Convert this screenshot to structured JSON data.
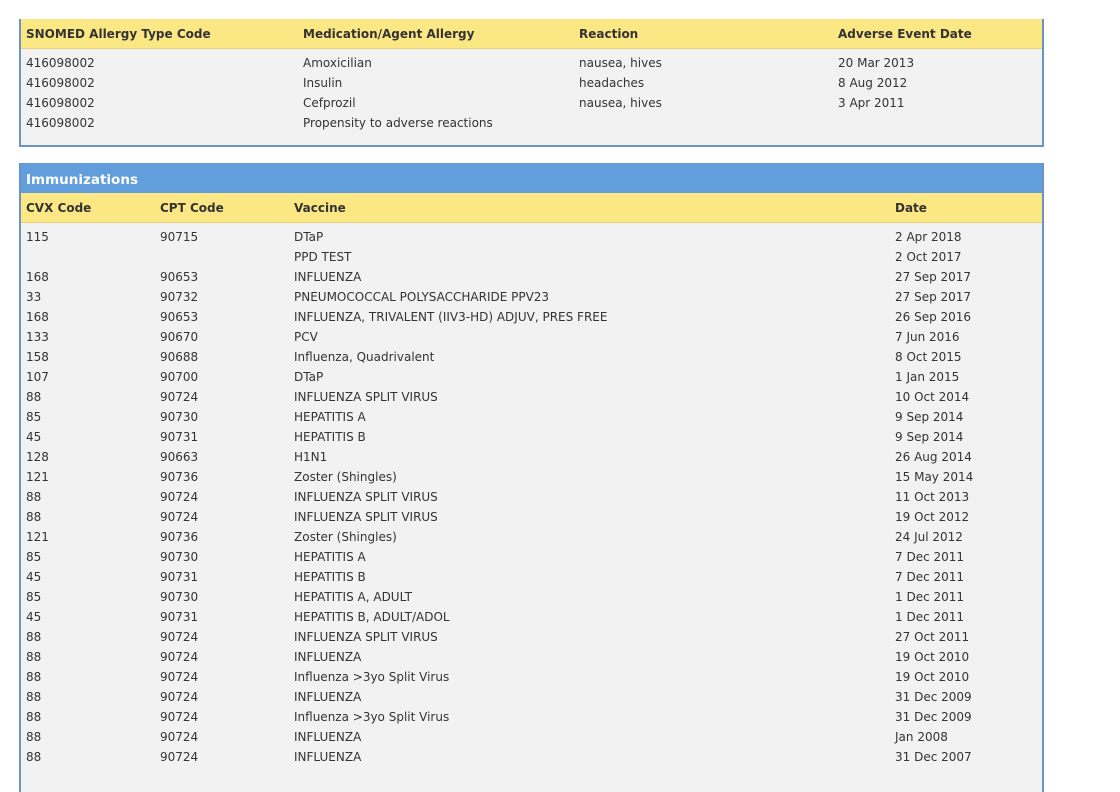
{
  "allergies": {
    "columns": [
      "SNOMED Allergy Type Code",
      "Medication/Agent Allergy",
      "Reaction",
      "Adverse Event Date"
    ],
    "rows": [
      {
        "code": "416098002",
        "agent": "Amoxicilian",
        "reaction": "nausea, hives",
        "date": "20 Mar 2013"
      },
      {
        "code": "416098002",
        "agent": "Insulin",
        "reaction": "headaches",
        "date": "8 Aug 2012"
      },
      {
        "code": "416098002",
        "agent": "Cefprozil",
        "reaction": "nausea, hives",
        "date": "3 Apr 2011"
      },
      {
        "code": "416098002",
        "agent": "Propensity to adverse reactions",
        "reaction": "",
        "date": ""
      }
    ]
  },
  "immunizations": {
    "title": "Immunizations",
    "columns": [
      "CVX Code",
      "CPT Code",
      "Vaccine",
      "Date"
    ],
    "rows": [
      {
        "cvx": "115",
        "cpt": "90715",
        "vaccine": "DTaP",
        "date": "2 Apr 2018"
      },
      {
        "cvx": "",
        "cpt": "",
        "vaccine": "PPD TEST",
        "date": "2 Oct 2017"
      },
      {
        "cvx": "168",
        "cpt": "90653",
        "vaccine": "INFLUENZA",
        "date": "27 Sep 2017"
      },
      {
        "cvx": "33",
        "cpt": "90732",
        "vaccine": "PNEUMOCOCCAL POLYSACCHARIDE PPV23",
        "date": "27 Sep 2017"
      },
      {
        "cvx": "168",
        "cpt": "90653",
        "vaccine": "INFLUENZA, TRIVALENT (IIV3-HD) ADJUV, PRES FREE",
        "date": "26 Sep 2016"
      },
      {
        "cvx": "133",
        "cpt": "90670",
        "vaccine": "PCV",
        "date": "7 Jun 2016"
      },
      {
        "cvx": "158",
        "cpt": "90688",
        "vaccine": "Influenza, Quadrivalent",
        "date": "8 Oct 2015"
      },
      {
        "cvx": "107",
        "cpt": "90700",
        "vaccine": "DTaP",
        "date": "1 Jan 2015"
      },
      {
        "cvx": "88",
        "cpt": "90724",
        "vaccine": "INFLUENZA SPLIT VIRUS",
        "date": "10 Oct 2014"
      },
      {
        "cvx": "85",
        "cpt": "90730",
        "vaccine": "HEPATITIS A",
        "date": "9 Sep 2014"
      },
      {
        "cvx": "45",
        "cpt": "90731",
        "vaccine": "HEPATITIS B",
        "date": "9 Sep 2014"
      },
      {
        "cvx": "128",
        "cpt": "90663",
        "vaccine": "H1N1",
        "date": "26 Aug 2014"
      },
      {
        "cvx": "121",
        "cpt": "90736",
        "vaccine": "Zoster (Shingles)",
        "date": "15 May 2014"
      },
      {
        "cvx": "88",
        "cpt": "90724",
        "vaccine": "INFLUENZA SPLIT VIRUS",
        "date": "11 Oct 2013"
      },
      {
        "cvx": "88",
        "cpt": "90724",
        "vaccine": "INFLUENZA SPLIT VIRUS",
        "date": "19 Oct 2012"
      },
      {
        "cvx": "121",
        "cpt": "90736",
        "vaccine": "Zoster (Shingles)",
        "date": "24 Jul 2012"
      },
      {
        "cvx": "85",
        "cpt": "90730",
        "vaccine": "HEPATITIS A",
        "date": "7 Dec 2011"
      },
      {
        "cvx": "45",
        "cpt": "90731",
        "vaccine": "HEPATITIS B",
        "date": "7 Dec 2011"
      },
      {
        "cvx": "85",
        "cpt": "90730",
        "vaccine": "HEPATITIS A, ADULT",
        "date": "1 Dec 2011"
      },
      {
        "cvx": "45",
        "cpt": "90731",
        "vaccine": "HEPATITIS B, ADULT/ADOL",
        "date": "1 Dec 2011"
      },
      {
        "cvx": "88",
        "cpt": "90724",
        "vaccine": "INFLUENZA SPLIT VIRUS",
        "date": "27 Oct 2011"
      },
      {
        "cvx": "88",
        "cpt": "90724",
        "vaccine": "INFLUENZA",
        "date": "19 Oct 2010"
      },
      {
        "cvx": "88",
        "cpt": "90724",
        "vaccine": "Influenza >3yo Split Virus",
        "date": "19 Oct 2010"
      },
      {
        "cvx": "88",
        "cpt": "90724",
        "vaccine": "INFLUENZA",
        "date": "31 Dec 2009"
      },
      {
        "cvx": "88",
        "cpt": "90724",
        "vaccine": "Influenza >3yo Split Virus",
        "date": "31 Dec 2009"
      },
      {
        "cvx": "88",
        "cpt": "90724",
        "vaccine": "INFLUENZA",
        "date": "Jan 2008"
      },
      {
        "cvx": "88",
        "cpt": "90724",
        "vaccine": "INFLUENZA",
        "date": "31 Dec 2007"
      }
    ]
  },
  "colors": {
    "section_header": "#629ddc",
    "column_header": "#fbe784",
    "panel_background": "#f2f2f2",
    "panel_border": "#6a93c6"
  }
}
